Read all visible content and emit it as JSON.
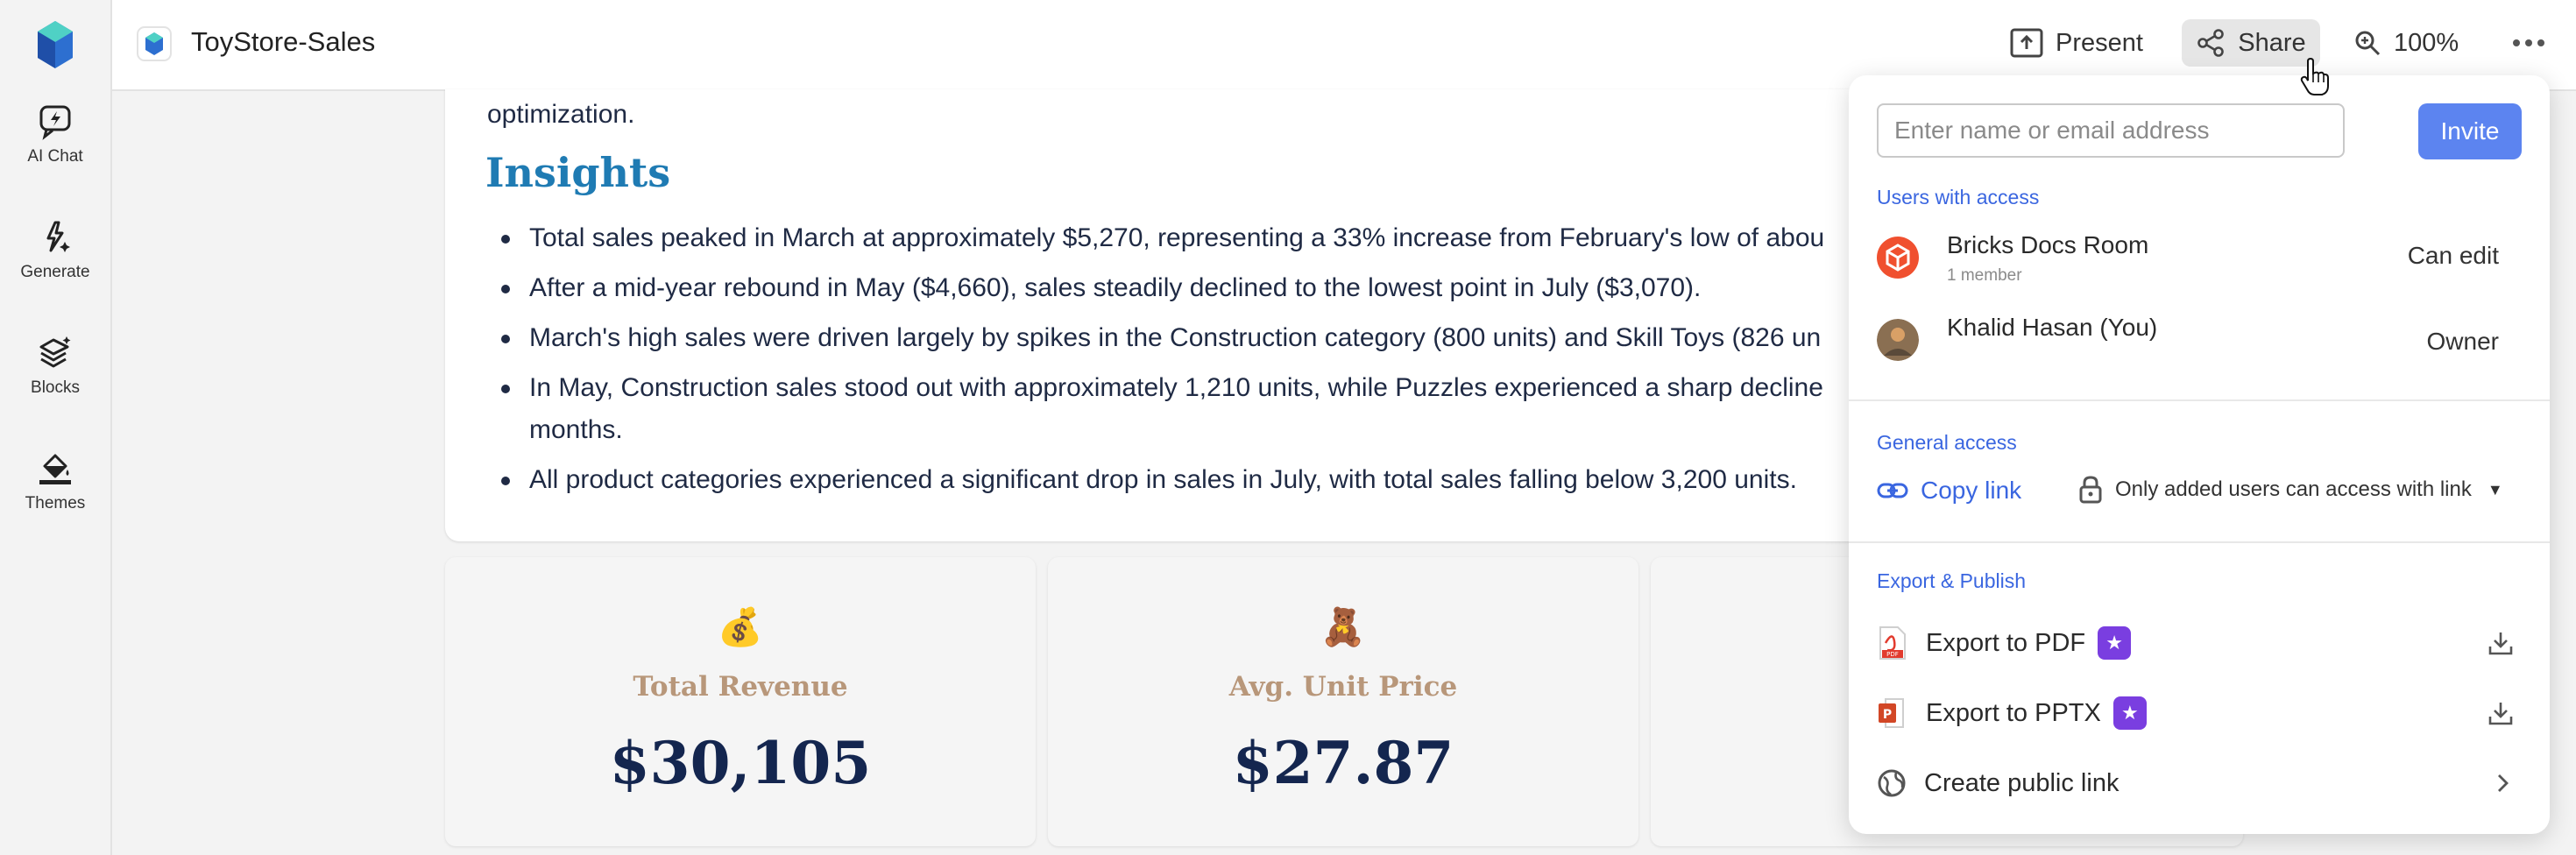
{
  "rail": {
    "items": [
      {
        "label": "AI Chat",
        "icon": "ai-chat-icon"
      },
      {
        "label": "Generate",
        "icon": "sparkle-icon"
      },
      {
        "label": "Blocks",
        "icon": "layers-icon"
      },
      {
        "label": "Themes",
        "icon": "paint-bucket-icon"
      }
    ]
  },
  "header": {
    "title": "ToyStore-Sales",
    "present_label": "Present",
    "share_label": "Share",
    "zoom_label": "100%"
  },
  "content": {
    "para_tail": "optimization.",
    "insights_heading": "Insights",
    "bullets": [
      "Total sales peaked in March at approximately $5,270, representing a 33% increase from February's low of abou",
      "After a mid-year rebound in May ($4,660), sales steadily declined to the lowest point in July ($3,070).",
      "March's high sales were driven largely by spikes in the Construction category (800 units) and Skill Toys (826 un",
      "In May, Construction sales stood out with approximately 1,210 units, while Puzzles experienced a sharp decline",
      "months.",
      "All product categories experienced a significant drop in sales in July, with total sales falling below 3,200 units."
    ]
  },
  "kpis": [
    {
      "emoji": "💰",
      "label": "Total Revenue",
      "value": "$30,105"
    },
    {
      "emoji": "🧸",
      "label": "Avg. Unit Price",
      "value": "$27.87"
    },
    {
      "emoji": "",
      "label": "",
      "value": ""
    }
  ],
  "share": {
    "input_placeholder": "Enter name or email address",
    "invite_label": "Invite",
    "users_title": "Users with access",
    "users": [
      {
        "name": "Bricks Docs Room",
        "sub": "1 member",
        "role": "Can edit"
      },
      {
        "name": "Khalid Hasan (You)",
        "sub": "",
        "role": "Owner"
      }
    ],
    "general_title": "General access",
    "copy_link_label": "Copy link",
    "access_option": "Only added users can access with link",
    "export_title": "Export & Publish",
    "exports": [
      {
        "label": "Export to PDF"
      },
      {
        "label": "Export to PPTX"
      },
      {
        "label": "Create public link"
      }
    ]
  },
  "colors": {
    "accent": "#3a66e0",
    "invite": "#5c84f0",
    "heading": "#1f7bb3",
    "kpi_label": "#b8977a",
    "kpi_value": "#14264f",
    "premium": "#7a3ee0"
  }
}
